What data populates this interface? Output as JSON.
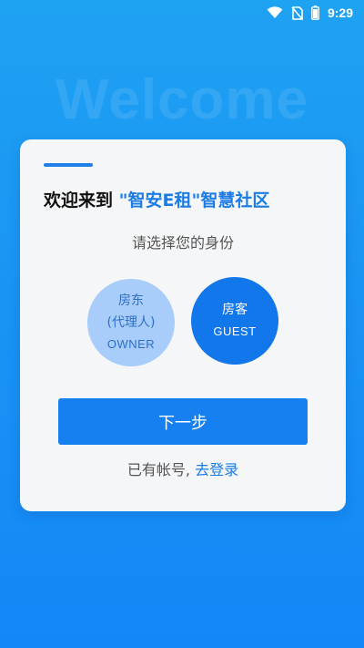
{
  "status_bar": {
    "time": "9:29",
    "icons": [
      "wifi-icon",
      "no-sim-icon",
      "battery-icon"
    ]
  },
  "background_text": "Welcome",
  "card": {
    "heading_prefix": "欢迎来到",
    "heading_brand": "\"智安E租\"智慧社区",
    "subtitle": "请选择您的身份",
    "roles": [
      {
        "line1": "房东",
        "line2": "(代理人)",
        "en": "OWNER",
        "selected": false
      },
      {
        "line1": "房客",
        "en": "GUEST",
        "selected": true
      }
    ],
    "next_button": "下一步",
    "has_account_text": "已有帐号,",
    "login_link": "去登录"
  },
  "colors": {
    "accent": "#1C7CE6",
    "button": "#1680F0",
    "owner_circle": "#A9CDFA",
    "guest_circle": "#1177EA"
  }
}
